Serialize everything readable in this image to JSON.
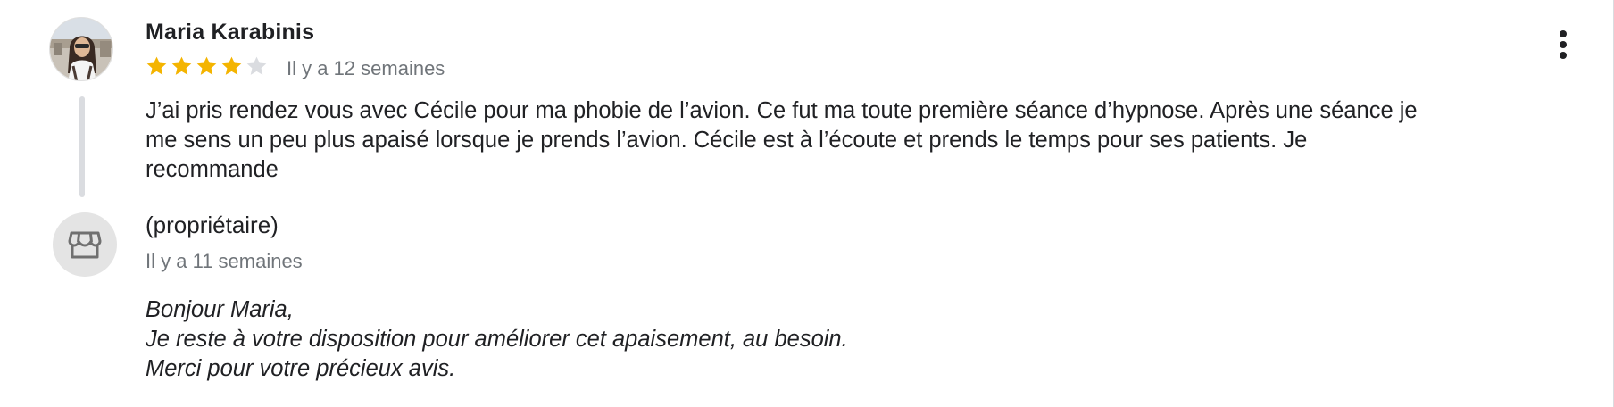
{
  "review": {
    "author": "Maria Karabinis",
    "rating": 4,
    "max_rating": 5,
    "date": "Il y a 12 semaines",
    "text": "J’ai pris rendez vous avec Cécile pour ma phobie de l’avion. Ce fut ma toute première séance d’hypnose. Après une séance je me sens un peu plus apaisé lorsque je prends l’avion. Cécile est à l’écoute et prends le temps pour ses patients. Je recommande"
  },
  "owner_response": {
    "label": "(propriétaire)",
    "date": "Il y a 11 semaines",
    "lines": [
      "Bonjour Maria,",
      "Je reste à votre disposition pour améliorer cet apaisement, au besoin.",
      "Merci pour votre précieux avis."
    ]
  },
  "icons": {
    "menu": "more-vert-icon",
    "owner": "storefront-icon",
    "star": "star-icon"
  },
  "colors": {
    "star_filled": "#f4b400",
    "star_empty": "#dadce0",
    "text_primary": "#202124",
    "text_secondary": "#70757a",
    "thread_line": "#dadce0",
    "owner_avatar_bg": "#e4e4e4"
  }
}
